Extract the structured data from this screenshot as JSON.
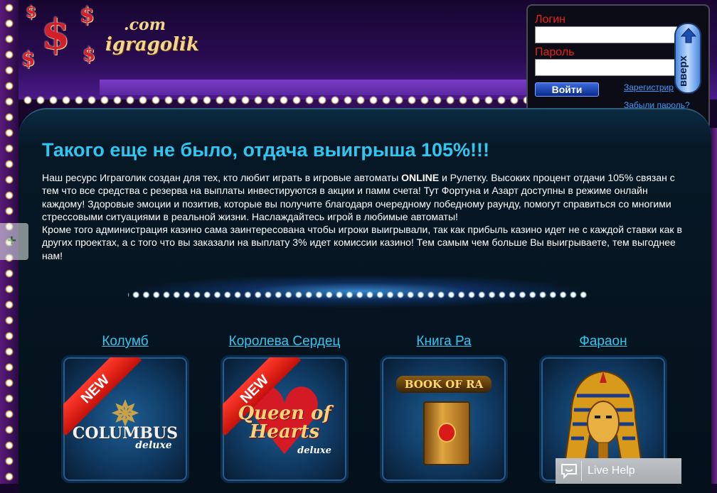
{
  "brand": {
    "dollar": "$",
    "domain": ".com",
    "name": "igragolik"
  },
  "login": {
    "login_label": "Логин",
    "password_label": "Пароль",
    "login_value": "",
    "password_value": "",
    "submit_label": "Войти",
    "register_link": "Зарегистрир",
    "forgot_link": "Забыли пароль?"
  },
  "scroll_up": {
    "label": "вверх"
  },
  "main": {
    "headline": "Такого еще не было, отдача выигрыша 105%!!!",
    "paragraph1_a": "Наш ресурс Играголик создан для тех, кто любит играть в игровые автоматы ",
    "paragraph1_bold": "ONLINE",
    "paragraph1_b": " и Рулетку. Высоких процент отдачи 105% связан с тем что все средства с резерва на выплаты инвестируются в акции и памм счета! Тут Фортуна и Азарт доступны в режиме онлайн каждому! Здоровые эмоции и позитив, которые вы получите благодаря очередному победному раунду, помогут справиться со многими стрессовыми ситуациями в реальной жизни. Наслаждайтесь игрой в любимые автоматы!",
    "paragraph2": "Кроме того администрация казино сама заинтересована чтобы игроки выигрывали, так как прибыль казино идет не с каждой ставки как в других проектах, а с того что вы заказали на выплату 3% идет комиссии казино! Тем самым чем больше Вы выигрываете, тем выгоднее нам!"
  },
  "side_widget": {
    "label": "+"
  },
  "games": [
    {
      "title": "Колумб",
      "badge": "NEW",
      "logo_line1": "COLUMBUS",
      "logo_line2": "deluxe"
    },
    {
      "title": "Королева Сердец",
      "badge": "NEW",
      "logo_line1": "Queen of Hearts",
      "logo_line2": "deluxe"
    },
    {
      "title": "Книга Ра",
      "badge": "",
      "logo_line1": "BOOK OF RA",
      "logo_line2": ""
    },
    {
      "title": "Фараон",
      "badge": "",
      "logo_line1": "",
      "logo_line2": ""
    }
  ],
  "live_help": {
    "label": "Live Help"
  },
  "colors": {
    "accent_cyan": "#31c6f0",
    "login_label_red": "#e52020",
    "link_blue": "#3d9bff",
    "ribbon_red": "#e0201a"
  }
}
